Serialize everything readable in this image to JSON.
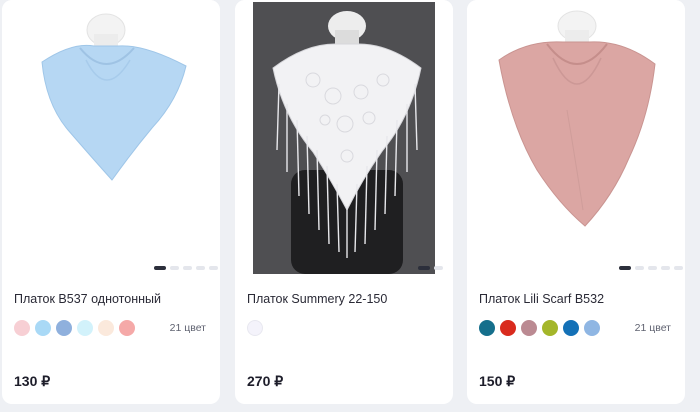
{
  "products": [
    {
      "title": "Платок B537 однотонный",
      "price": "130 ₽",
      "color_count": "21 цвет",
      "image_icon": "light-blue-scarf-on-mannequin",
      "scarf_color": "#b6d7f3",
      "image_bg": "#ffffff",
      "carousel_active": 0,
      "swatches": [
        "#f7cfd4",
        "#a9d9f6",
        "#8fb0dd",
        "#d2f2fb",
        "#fbe9dc",
        "#f5a9a8"
      ]
    },
    {
      "title": "Платок Summery 22-150",
      "price": "270 ₽",
      "color_count": "",
      "image_icon": "white-lace-fringe-scarf-on-black-mannequin",
      "scarf_color": "#f2f2f4",
      "image_bg": "#4f4f52",
      "carousel_active": 0,
      "swatches": [
        "#f4f3fb"
      ]
    },
    {
      "title": "Платок Lili Scarf B532",
      "price": "150 ₽",
      "color_count": "21 цвет",
      "image_icon": "pink-scarf-on-mannequin",
      "scarf_color": "#dba6a3",
      "image_bg": "#ffffff",
      "carousel_active": 0,
      "swatches": [
        "#156f8c",
        "#d92b1e",
        "#bb8a92",
        "#a4b62a",
        "#1471b7",
        "#8fb6e3"
      ]
    }
  ]
}
